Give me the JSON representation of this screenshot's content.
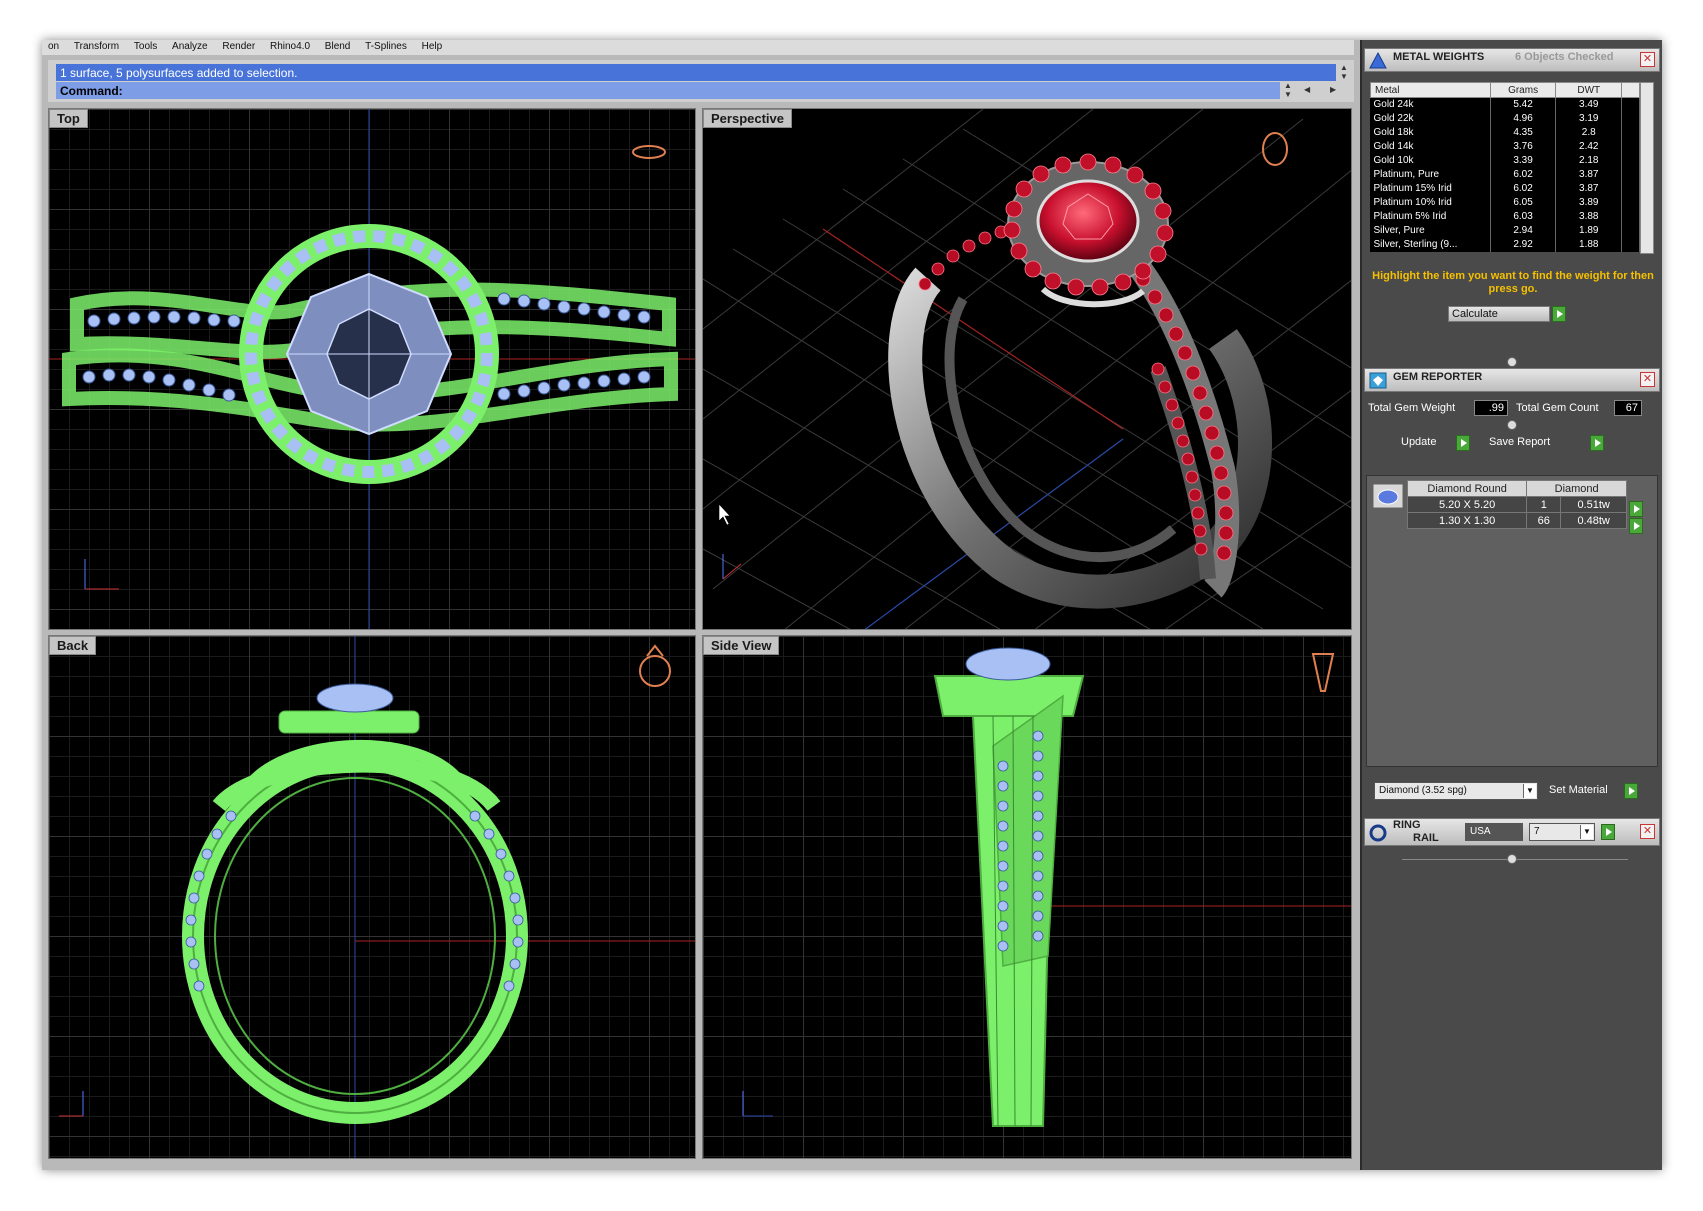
{
  "menu": [
    "on",
    "Transform",
    "Tools",
    "Analyze",
    "Render",
    "Rhino4.0",
    "Blend",
    "T-Splines",
    "Help"
  ],
  "command": {
    "history": "1 surface, 5 polysurfaces added to selection.",
    "prompt": "Command:"
  },
  "viewports": {
    "top": "Top",
    "perspective": "Perspective",
    "back": "Back",
    "side": "Side View"
  },
  "metal_weights": {
    "title": "METAL WEIGHTS",
    "objects_checked": "6 Objects Checked",
    "columns": [
      "Metal",
      "Grams",
      "DWT"
    ],
    "rows": [
      [
        "Gold 24k",
        "5.42",
        "3.49"
      ],
      [
        "Gold 22k",
        "4.96",
        "3.19"
      ],
      [
        "Gold 18k",
        "4.35",
        "2.8"
      ],
      [
        "Gold 14k",
        "3.76",
        "2.42"
      ],
      [
        "Gold 10k",
        "3.39",
        "2.18"
      ],
      [
        "Platinum, Pure",
        "6.02",
        "3.87"
      ],
      [
        "Platinum 15% Irid",
        "6.02",
        "3.87"
      ],
      [
        "Platinum 10% Irid",
        "6.05",
        "3.89"
      ],
      [
        "Platinum 5% Irid",
        "6.03",
        "3.88"
      ],
      [
        "Silver, Pure",
        "2.94",
        "1.89"
      ],
      [
        "Silver, Sterling (9...",
        "2.92",
        "1.88"
      ]
    ],
    "help_text": "Highlight the item you want to find the weight for then press go.",
    "calculate_label": "Calculate"
  },
  "gem_reporter": {
    "title": "GEM REPORTER",
    "total_weight_label": "Total Gem Weight",
    "total_weight": ".99",
    "total_count_label": "Total Gem Count",
    "total_count": "67",
    "update_label": "Update",
    "save_report_label": "Save Report",
    "columns": [
      "Diamond Round",
      "Diamond"
    ],
    "rows": [
      [
        "5.20 X 5.20",
        "1",
        "0.51tw"
      ],
      [
        "1.30 X 1.30",
        "66",
        "0.48tw"
      ]
    ],
    "material_select": "Diamond     (3.52 spg)",
    "set_material_label": "Set Material"
  },
  "ring_rail": {
    "title_line1": "RING",
    "title_line2": "RAIL",
    "standard": "USA",
    "size": "7"
  },
  "colors": {
    "wireframe": "#7cf06a",
    "gem_wire": "#a8c0f4",
    "ruby": "#c8102e",
    "metal": "#9a9a9a",
    "panel_bg": "#4a4a4a",
    "help_text": "#f5c000",
    "command_highlight": "#4873d8"
  }
}
